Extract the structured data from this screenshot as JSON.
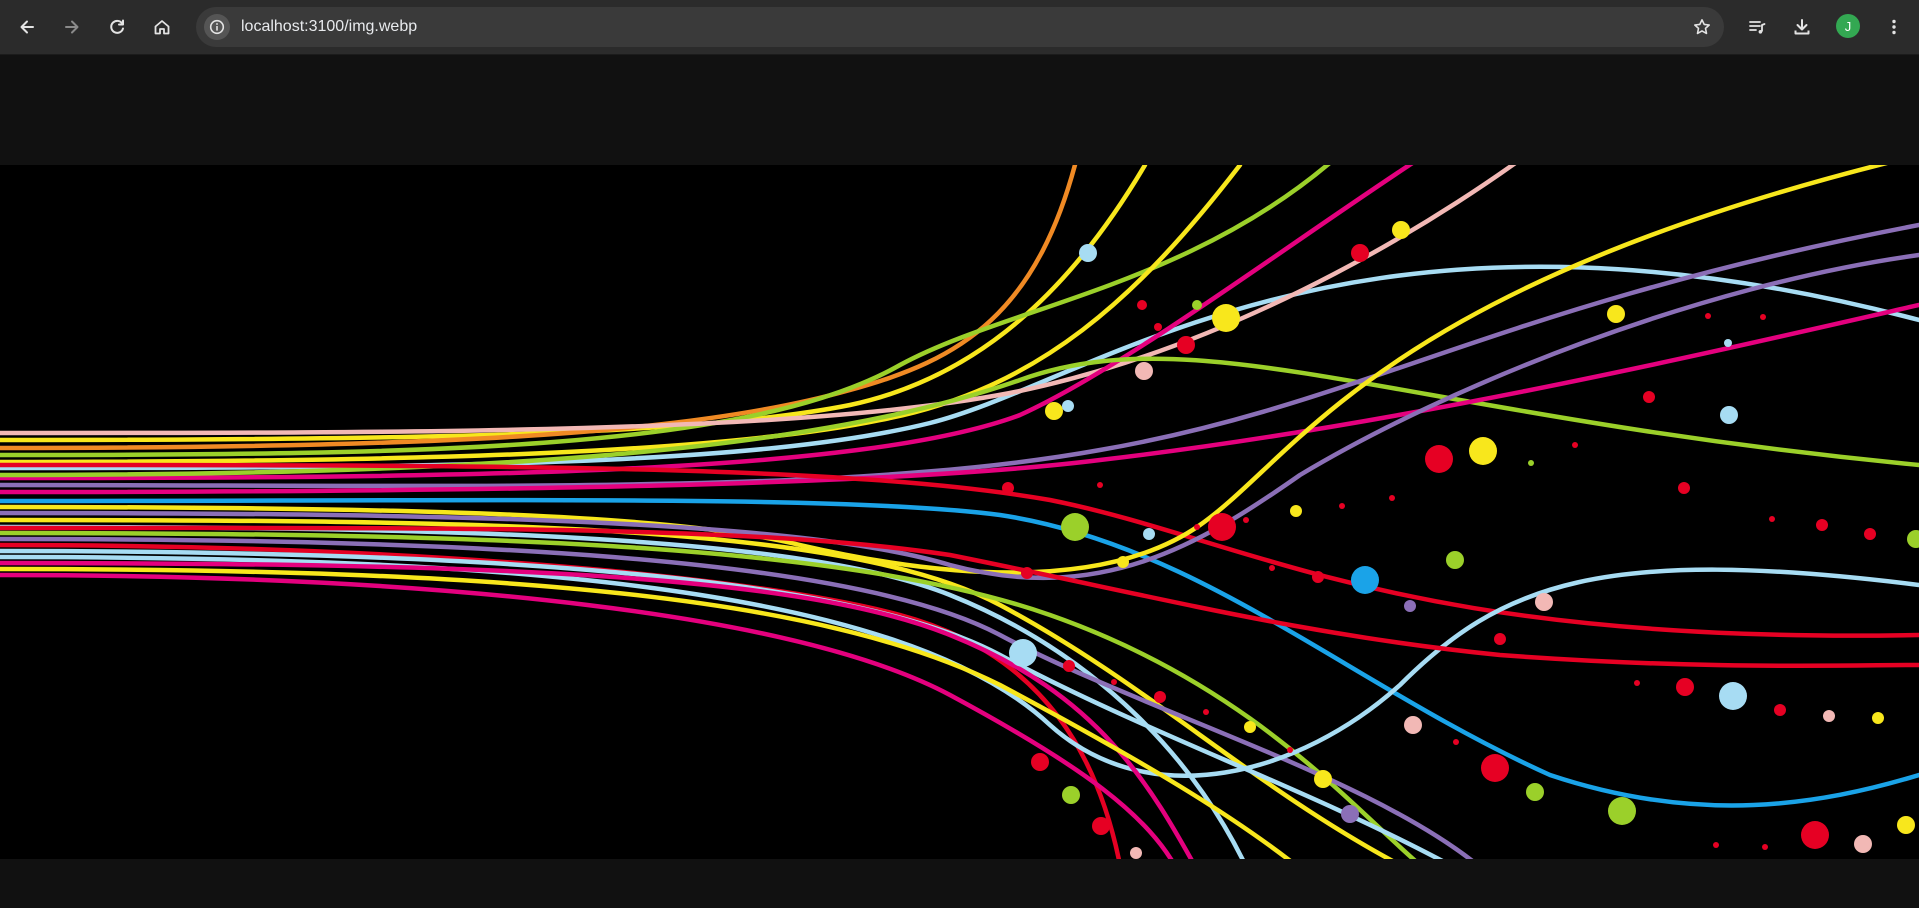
{
  "browser": {
    "url": "localhost:3100/img.webp",
    "profile_initial": "J",
    "theme_color": "#2b2b2b",
    "icons": {
      "back": "arrow-left-icon",
      "forward": "arrow-right-icon",
      "reload": "reload-icon",
      "home": "home-icon",
      "site_info": "info-icon",
      "bookmark": "star-icon",
      "media": "media-control-icon",
      "downloads": "download-icon",
      "menu": "kebab-menu-icon"
    }
  },
  "viewer": {
    "background": "#000000",
    "artwork": "colorful-flowing-lines",
    "line_colors": [
      "#f2b8b5",
      "#9bd02a",
      "#f8e71c",
      "#e4007e",
      "#e60023",
      "#1aa3e8",
      "#a7dcf3",
      "#8b6fb7",
      "#f08a24"
    ]
  }
}
